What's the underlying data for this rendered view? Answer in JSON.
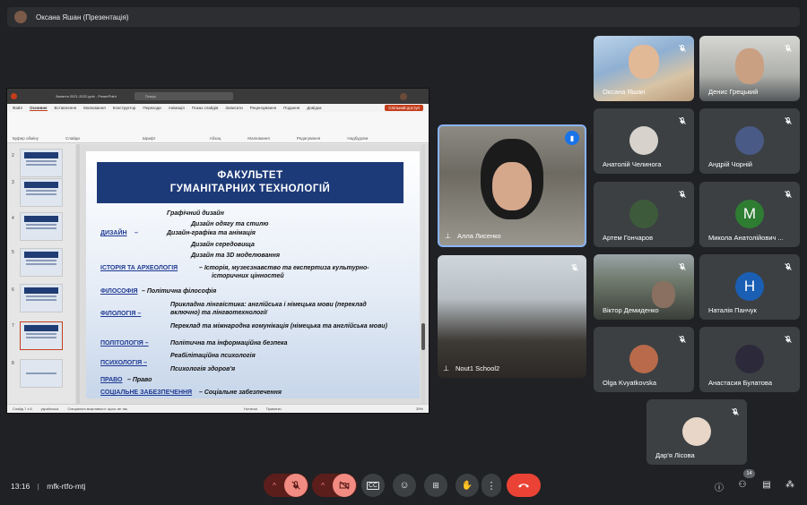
{
  "presenter_bar": {
    "label": "Оксана Яшан (Презентація)"
  },
  "powerpoint": {
    "file_name": "Заняття 2021-2022.pptx - PowerPoint",
    "search_placeholder": "Пошук",
    "menu": [
      "Файл",
      "Основне",
      "Вставлення",
      "Малювання",
      "Конструктор",
      "Переходи",
      "Анімація",
      "Показ слайдів",
      "Записати",
      "Рецензування",
      "Подання",
      "Довідка"
    ],
    "active_menu": "Основне",
    "share_button": "Спільний доступ",
    "ribbon_groups": [
      "Буфер обміну",
      "Слайди",
      "Шрифт",
      "Абзац",
      "Малювання",
      "Редагування",
      "Надбудови"
    ],
    "status_left": "Слайд 7 з 8",
    "status_lang": "українська",
    "status_accessibility": "Спеціальні можливості: щось не так",
    "status_notes": "Нотатки",
    "status_comments": "Примітки",
    "zoom": "39%",
    "thumb_numbers": [
      "1",
      "2",
      "3",
      "4",
      "5",
      "6",
      "7",
      "8"
    ]
  },
  "slide": {
    "title_line1": "ФАКУЛЬТЕТ",
    "title_line2": "ГУМАНІТАРНИХ ТЕХНОЛОГІЙ",
    "design_key": "ДИЗАЙН",
    "design_dash": "–",
    "design_items": [
      "Графічний дизайн",
      "Дизайн одягу та стилю",
      "Дизайн-графіка та анімація",
      "Дизайн середовища",
      "Дизайн та 3D моделювання"
    ],
    "history_key": "ІСТОРІЯ ТА АРХЕОЛОГІЯ",
    "history_text": "– Історія, музеєзнавство та експертиза культурно-",
    "history_text2": "історичних цінностей",
    "philosophy_key": "ФІЛОСОФІЯ",
    "philosophy_text": "– Політична філософія",
    "philology_key": "ФІЛОЛОГІЯ –",
    "philology_items": [
      "Прикладна лінгвістика: англійська і німецька мови (переклад",
      "включно) та лінгвотехнології",
      "Переклад та міжнародна комунікація (німецька та англійська мови)"
    ],
    "politology_key": "ПОЛІТОЛОГІЯ –",
    "politology_text": "Політична та інформаційна безпека",
    "psychology_key": "ПСИХОЛОГІЯ –",
    "psychology_items": [
      "Реабілітаційна психологія",
      "Психологія здоров'я"
    ],
    "law_key": "ПРАВО",
    "law_text": "– Право",
    "social_key": "СОЦІАЛЬНЕ ЗАБЕЗПЕЧЕННЯ",
    "social_text": "– Соціальне забезпечення"
  },
  "participants": [
    {
      "name": "Оксана Яшан"
    },
    {
      "name": "Денис Грецький"
    },
    {
      "name": "Алла Лисенко"
    },
    {
      "name": "Анатолій Челинога"
    },
    {
      "name": "Андрій Чорній"
    },
    {
      "name": "Артем Гончаров"
    },
    {
      "name": "Микола Анатолійович ...",
      "letter": "M"
    },
    {
      "name": "Nout1 School2"
    },
    {
      "name": "Віктор Демиденко"
    },
    {
      "name": "Наталія Панчук",
      "letter": "Н"
    },
    {
      "name": "Olga Kvyatkovska"
    },
    {
      "name": "Анастасия Булатова"
    },
    {
      "name": "Дар'я Лісова"
    }
  ],
  "meeting": {
    "time": "13:16",
    "code": "mfk-rtfo-mtj",
    "participant_count": "14"
  },
  "colors": {
    "end_call": "#ea4335",
    "muted": "#f28b82",
    "muted_bg": "#5c1e1b",
    "speaking": "#8ab4f8"
  }
}
